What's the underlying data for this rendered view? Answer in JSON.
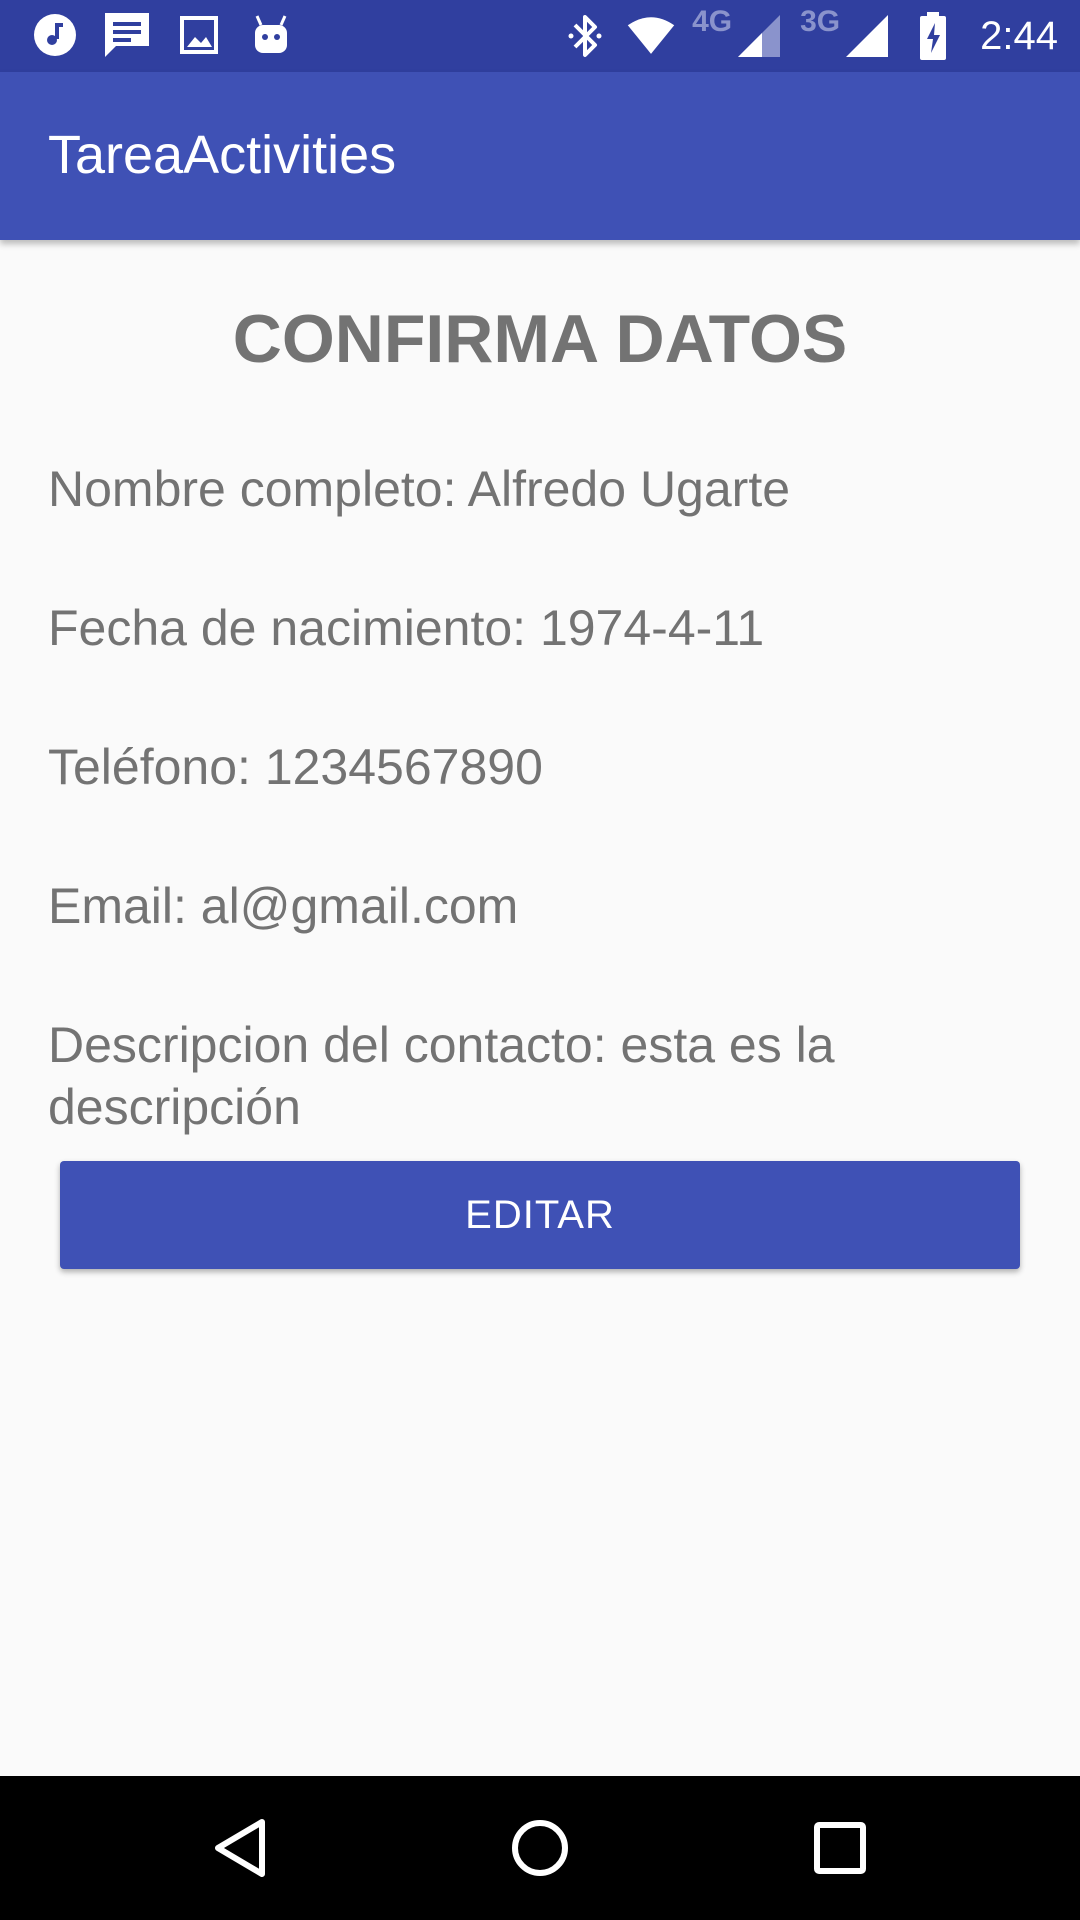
{
  "status_bar": {
    "left_icons": [
      "music-icon",
      "message-icon",
      "image-icon",
      "android-icon"
    ],
    "right_icons": [
      "bluetooth-icon",
      "wifi-icon",
      "signal-4g-icon",
      "signal-3g-icon",
      "battery-charging-icon"
    ],
    "network_4g": "4G",
    "network_3g": "3G",
    "time": "2:44"
  },
  "app_bar": {
    "title": "TareaActivities"
  },
  "content": {
    "heading": "CONFIRMA DATOS",
    "full_name": "Nombre completo: Alfredo Ugarte",
    "birth_date": "Fecha de nacimiento: 1974-4-11",
    "phone": "Teléfono: 1234567890",
    "email": "Email: al@gmail.com",
    "description": "Descripcion del contacto: esta es la descripción",
    "edit_button": "EDITAR"
  },
  "nav_bar": {
    "icons": [
      "back-icon",
      "home-icon",
      "recents-icon"
    ]
  },
  "colors": {
    "status_bar": "#303f9f",
    "primary": "#3f51b5",
    "text": "#737373",
    "background": "#fafafa"
  }
}
